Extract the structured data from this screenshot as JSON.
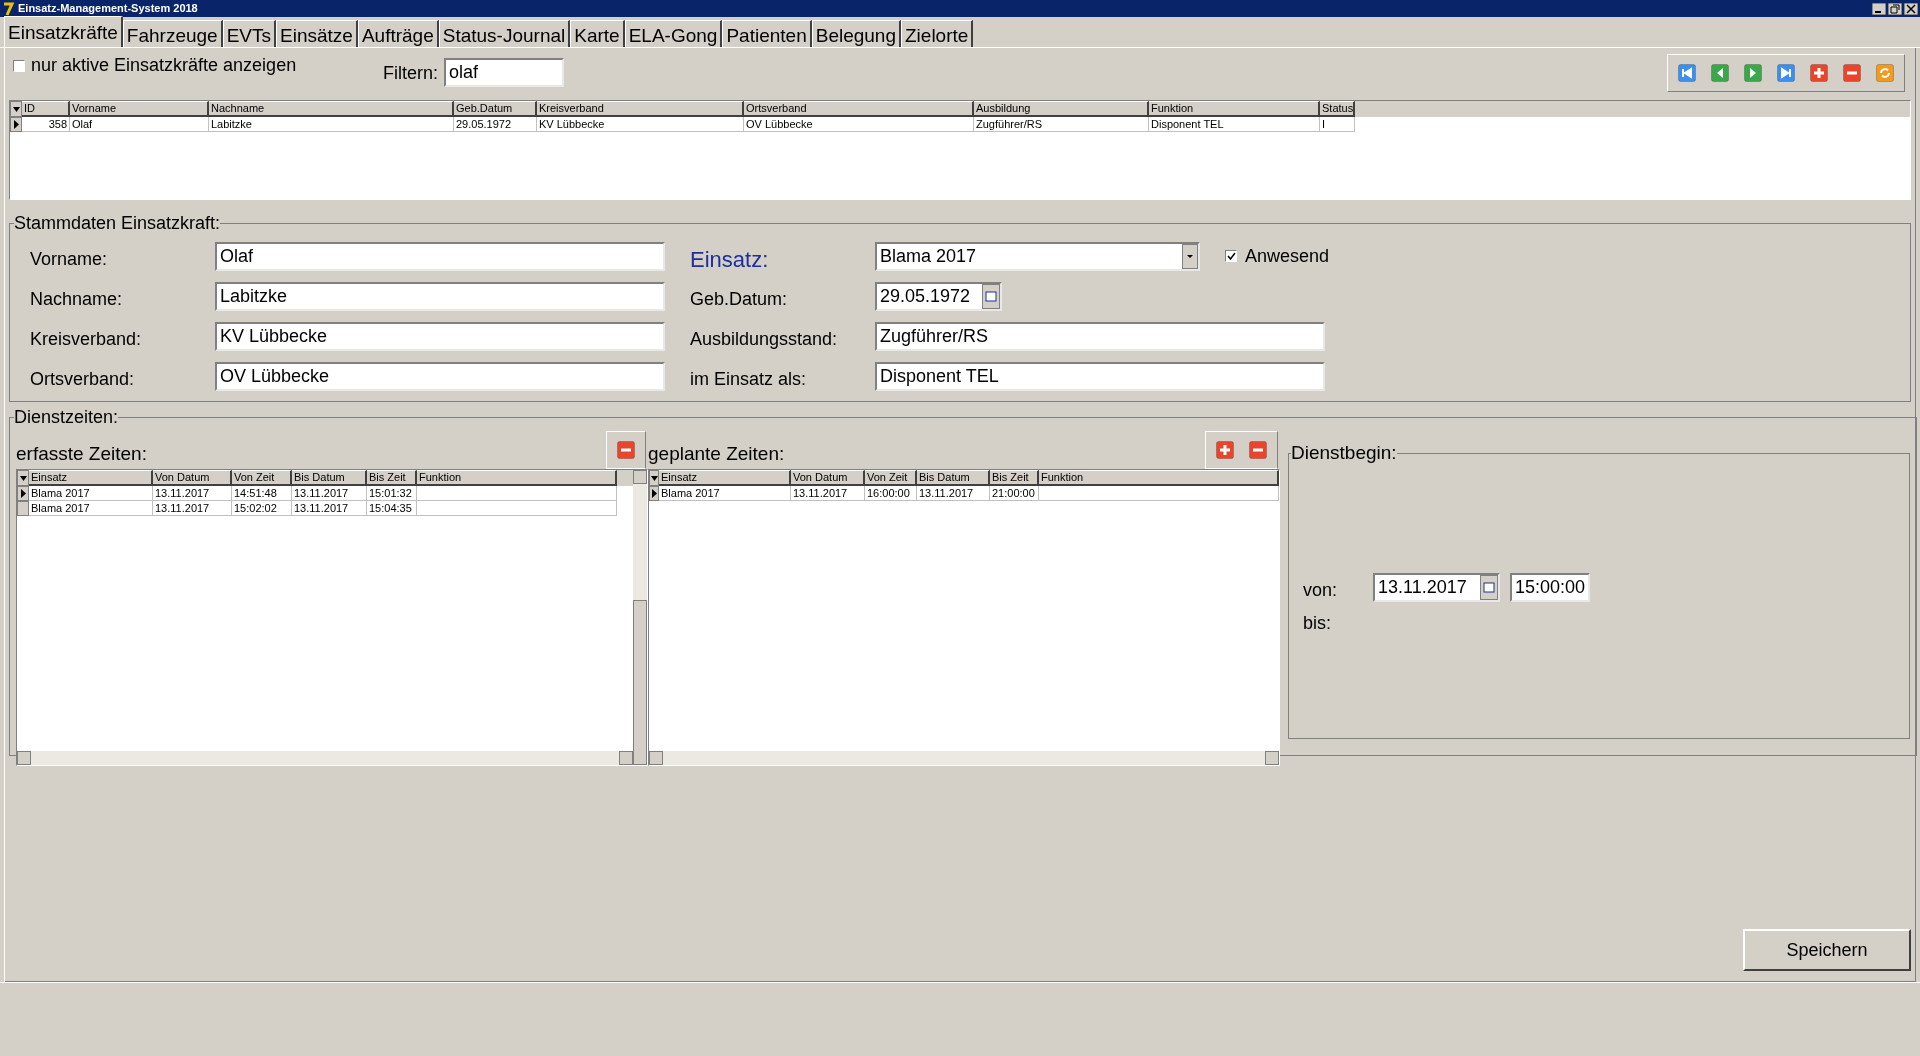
{
  "window": {
    "title": "Einsatz-Management-System 2018"
  },
  "tabs": [
    {
      "label": "Einsatzkräfte",
      "selected": true
    },
    {
      "label": "Fahrzeuge",
      "selected": false
    },
    {
      "label": "EVTs",
      "selected": false
    },
    {
      "label": "Einsätze",
      "selected": false
    },
    {
      "label": "Aufträge",
      "selected": false
    },
    {
      "label": "Status-Journal",
      "selected": false
    },
    {
      "label": "Karte",
      "selected": false
    },
    {
      "label": "ELA-Gong",
      "selected": false
    },
    {
      "label": "Patienten",
      "selected": false
    },
    {
      "label": "Belegung",
      "selected": false
    },
    {
      "label": "Zielorte",
      "selected": false
    }
  ],
  "filter": {
    "checkbox_label": "nur aktive Einsatzkräfte anzeigen",
    "checked": false,
    "label": "Filtern:",
    "value": "olaf"
  },
  "main_grid": {
    "columns": [
      "ID",
      "Vorname",
      "Nachname",
      "Geb.Datum",
      "Kreisverband",
      "Ortsverband",
      "Ausbildung",
      "Funktion",
      "Status"
    ],
    "rows": [
      {
        "selected": true,
        "cells": [
          "358",
          "Olaf",
          "Labitzke",
          "29.05.1972",
          "KV Lübbecke",
          "OV Lübbecke",
          "Zugführer/RS",
          "Disponent TEL",
          "I"
        ]
      }
    ]
  },
  "stammdaten": {
    "title": "Stammdaten Einsatzkraft:",
    "left_fields": [
      {
        "label": "Vorname:",
        "value": "Olaf"
      },
      {
        "label": "Nachname:",
        "value": "Labitzke"
      },
      {
        "label": "Kreisverband:",
        "value": "KV Lübbecke"
      },
      {
        "label": "Ortsverband:",
        "value": "OV Lübbecke"
      }
    ],
    "einsatz": {
      "label": "Einsatz:",
      "value": "Blama 2017"
    },
    "anwesend": {
      "label": "Anwesend",
      "checked": true
    },
    "geb_datum": {
      "label": "Geb.Datum:",
      "value": "29.05.1972"
    },
    "right_fields": [
      {
        "label": "Ausbildungsstand:",
        "value": "Zugführer/RS"
      },
      {
        "label": "im Einsatz als:",
        "value": "Disponent TEL"
      }
    ]
  },
  "dienstzeiten": {
    "title": "Dienstzeiten:",
    "erfasst": {
      "title": "erfasste Zeiten:",
      "columns": [
        "Einsatz",
        "Von Datum",
        "Von Zeit",
        "Bis Datum",
        "Bis Zeit",
        "Funktion"
      ],
      "rows": [
        {
          "selected": true,
          "cells": [
            "Blama 2017",
            "13.11.2017",
            "14:51:48",
            "13.11.2017",
            "15:01:32",
            ""
          ]
        },
        {
          "selected": false,
          "cells": [
            "Blama 2017",
            "13.11.2017",
            "15:02:02",
            "13.11.2017",
            "15:04:35",
            ""
          ]
        }
      ]
    },
    "geplant": {
      "title": "geplante Zeiten:",
      "columns": [
        "Einsatz",
        "Von Datum",
        "Von Zeit",
        "Bis Datum",
        "Bis Zeit",
        "Funktion"
      ],
      "rows": [
        {
          "selected": true,
          "cells": [
            "Blama 2017",
            "13.11.2017",
            "16:00:00",
            "13.11.2017",
            "21:00:00",
            ""
          ]
        }
      ]
    },
    "dienstbegin": {
      "title": "Dienstbegin:",
      "von_label": "von:",
      "date": "13.11.2017",
      "time": "15:00:00",
      "bis_label": "bis:"
    }
  },
  "save_button": {
    "label": "Speichern"
  }
}
